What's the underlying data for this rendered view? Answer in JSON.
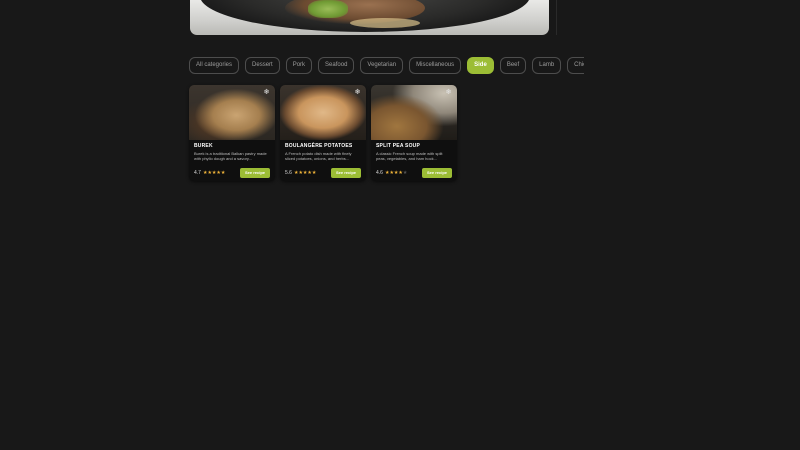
{
  "categories": [
    {
      "label": "All categories",
      "active": false
    },
    {
      "label": "Dessert",
      "active": false
    },
    {
      "label": "Pork",
      "active": false
    },
    {
      "label": "Seafood",
      "active": false
    },
    {
      "label": "Vegetarian",
      "active": false
    },
    {
      "label": "Miscellaneous",
      "active": false
    },
    {
      "label": "Side",
      "active": true
    },
    {
      "label": "Beef",
      "active": false
    },
    {
      "label": "Lamb",
      "active": false
    },
    {
      "label": "Chicken",
      "active": false
    }
  ],
  "recipes": [
    {
      "title": "BUREK",
      "description": "Burek is a traditional Balkan pastry made with phyllo dough and a savory...",
      "rating": "4.7",
      "stars": 5,
      "button": "See recipe"
    },
    {
      "title": "BOULANGÈRE POTATOES",
      "description": "A French potato dish made with finely sliced potatoes, onions, and herbs...",
      "rating": "5.6",
      "stars": 5,
      "button": "See recipe"
    },
    {
      "title": "SPLIT PEA SOUP",
      "description": "A classic French soup made with split peas, vegetables, and ham hock...",
      "rating": "4.6",
      "stars": 4,
      "button": "See recipe"
    }
  ],
  "colors": {
    "accent": "#9cbd35",
    "background": "#181818",
    "star": "#f0b43a"
  },
  "icons": {
    "favorite": "snowflake-icon",
    "star": "star-icon"
  }
}
